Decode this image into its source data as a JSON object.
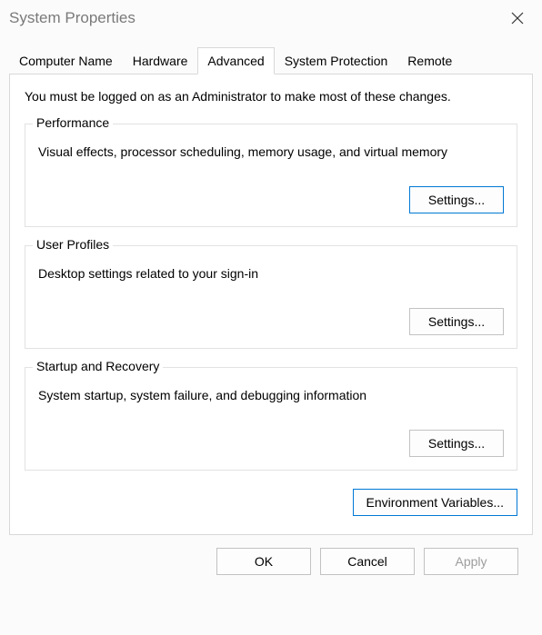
{
  "window": {
    "title": "System Properties"
  },
  "tabs": {
    "computer_name": "Computer Name",
    "hardware": "Hardware",
    "advanced": "Advanced",
    "system_protection": "System Protection",
    "remote": "Remote"
  },
  "intro_text": "You must be logged on as an Administrator to make most of these changes.",
  "groups": {
    "performance": {
      "legend": "Performance",
      "desc": "Visual effects, processor scheduling, memory usage, and virtual memory",
      "settings_label": "Settings..."
    },
    "user_profiles": {
      "legend": "User Profiles",
      "desc": "Desktop settings related to your sign-in",
      "settings_label": "Settings..."
    },
    "startup_recovery": {
      "legend": "Startup and Recovery",
      "desc": "System startup, system failure, and debugging information",
      "settings_label": "Settings..."
    }
  },
  "env_vars_label": "Environment Variables...",
  "buttons": {
    "ok": "OK",
    "cancel": "Cancel",
    "apply": "Apply"
  }
}
